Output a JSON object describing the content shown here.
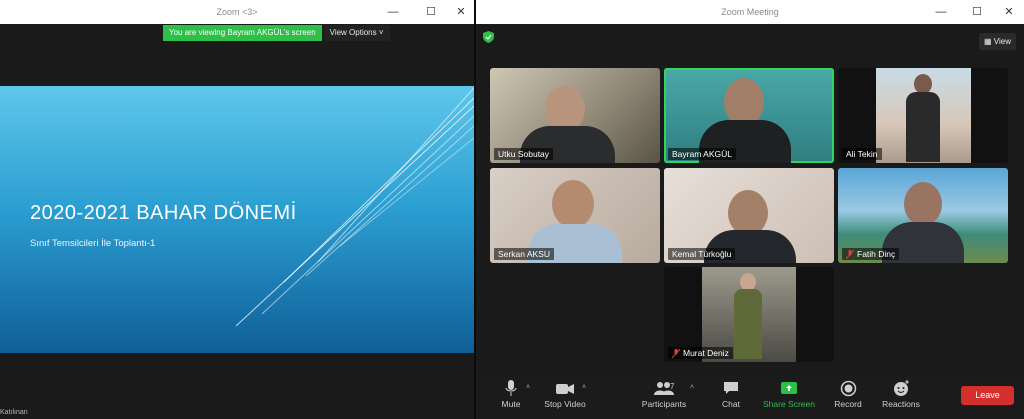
{
  "left_window": {
    "title": "Zoom <3>",
    "viewing_banner": "You are viewing Bayram AKGÜL's screen",
    "view_options": "View Options",
    "slide": {
      "title": "2020-2021 BAHAR DÖNEMİ",
      "subtitle": "Sınıf Temsilcileri İle Toplantı-1"
    },
    "bottom_text": "Katılınan"
  },
  "right_window": {
    "title": "Zoom Meeting",
    "view_button": "View",
    "participants": [
      {
        "name": "Utku Sobutay",
        "muted": false,
        "active": false
      },
      {
        "name": "Bayram AKGÜL",
        "muted": false,
        "active": true
      },
      {
        "name": "Ali Tekin",
        "muted": false,
        "active": false
      },
      {
        "name": "Serkan AKSU",
        "muted": false,
        "active": false
      },
      {
        "name": "Kemal Türkoğlu",
        "muted": false,
        "active": false
      },
      {
        "name": "Fatih Dinç",
        "muted": true,
        "active": false
      },
      {
        "name": "Murat Deniz",
        "muted": true,
        "active": false
      }
    ],
    "toolbar": {
      "mute": "Mute",
      "stop_video": "Stop Video",
      "participants": "Participants",
      "participants_count": "7",
      "chat": "Chat",
      "share_screen": "Share Screen",
      "record": "Record",
      "reactions": "Reactions",
      "leave": "Leave"
    }
  },
  "colors": {
    "accent_green": "#2dbf4a",
    "active_speaker": "#2fd65a",
    "leave_red": "#d3302d"
  }
}
